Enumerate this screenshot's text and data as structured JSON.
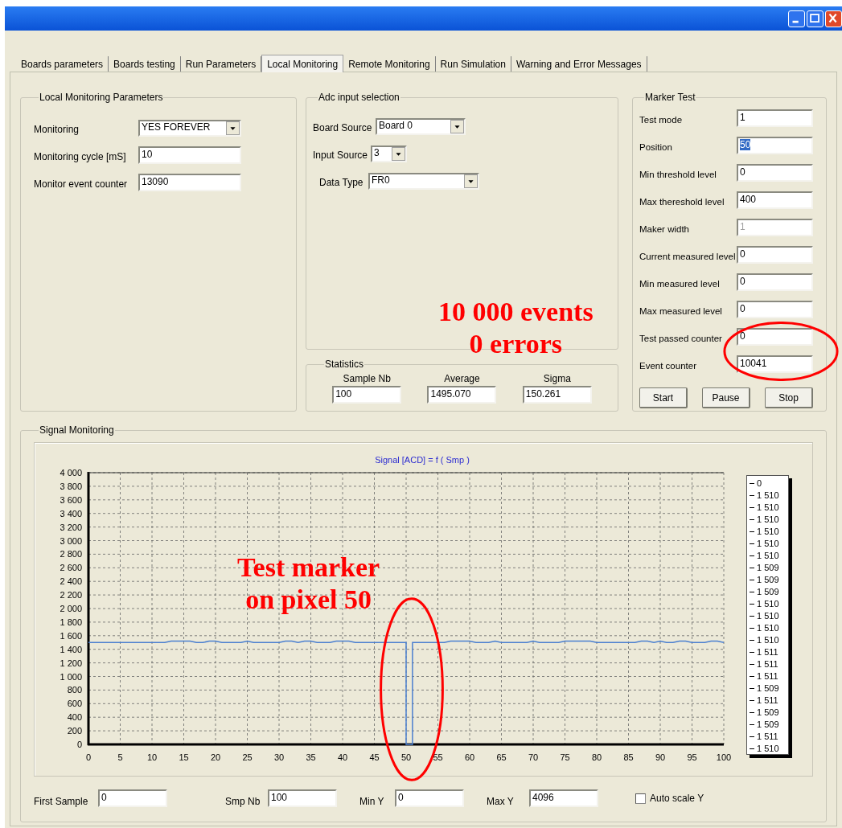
{
  "window": {
    "controls": [
      {
        "kind": "minimize"
      },
      {
        "kind": "maximize"
      },
      {
        "kind": "close"
      }
    ]
  },
  "tabs": [
    {
      "label": "Boards parameters",
      "selected": false
    },
    {
      "label": "Boards testing",
      "selected": false
    },
    {
      "label": "Run Parameters",
      "selected": false
    },
    {
      "label": "Local Monitoring",
      "selected": true
    },
    {
      "label": "Remote Monitoring",
      "selected": false
    },
    {
      "label": "Run Simulation",
      "selected": false
    },
    {
      "label": "Warning and Error Messages",
      "selected": false
    }
  ],
  "local_monitoring_parameters": {
    "title": "Local Monitoring Parameters",
    "rows": [
      {
        "label": "Monitoring",
        "kind": "dropdown",
        "value": "YES FOREVER"
      },
      {
        "label": "Monitoring cycle [mS]",
        "kind": "input",
        "value": "10"
      },
      {
        "label": "Monitor event counter",
        "kind": "input",
        "value": "13090"
      }
    ]
  },
  "adc_input_selection": {
    "title": "Adc input selection",
    "rows": [
      {
        "label": "Board Source",
        "kind": "dropdown",
        "value": "Board 0"
      },
      {
        "label": "Input Source",
        "kind": "dropdown",
        "value": "3"
      },
      {
        "label": "Data Type",
        "kind": "dropdown",
        "value": "FR0"
      }
    ]
  },
  "statistics": {
    "title": "Statistics",
    "columns": [
      {
        "label": "Sample Nb",
        "value": "100"
      },
      {
        "label": "Average",
        "value": "1495.070"
      },
      {
        "label": "Sigma",
        "value": "150.261"
      }
    ]
  },
  "marker_test": {
    "title": "Marker Test",
    "rows": [
      {
        "label": "Test mode",
        "value": "1",
        "disabled": false,
        "text_selected": false
      },
      {
        "label": "Position",
        "value": "50",
        "disabled": false,
        "text_selected": true
      },
      {
        "label": "Min threshold level",
        "value": "0",
        "disabled": false,
        "text_selected": false
      },
      {
        "label": "Max thereshold level",
        "value": "400",
        "disabled": false,
        "text_selected": false
      },
      {
        "label": "Maker width",
        "value": "1",
        "disabled": true,
        "text_selected": false
      },
      {
        "label": "Current measured level",
        "value": "0",
        "disabled": false,
        "text_selected": false
      },
      {
        "label": "Min measured level",
        "value": "0",
        "disabled": false,
        "text_selected": false
      },
      {
        "label": "Max measured level",
        "value": "0",
        "disabled": false,
        "text_selected": false
      },
      {
        "label": "Test passed counter",
        "value": "0",
        "disabled": false,
        "text_selected": false
      },
      {
        "label": "Event counter",
        "value": "10041",
        "disabled": false,
        "text_selected": false
      }
    ],
    "buttons": [
      "Start",
      "Pause",
      "Stop"
    ]
  },
  "signal_monitoring": {
    "title": "Signal Monitoring",
    "chart_data": {
      "type": "line",
      "title": "Signal [ACD] = f ( Smp )",
      "grid": true,
      "xlim": [
        0,
        100
      ],
      "ylim": [
        0,
        4000
      ],
      "xticks": [
        0,
        5,
        10,
        15,
        20,
        25,
        30,
        35,
        40,
        45,
        50,
        55,
        60,
        65,
        70,
        75,
        80,
        85,
        90,
        95,
        100
      ],
      "yticks": [
        {
          "value": 4000,
          "label": "4 000"
        },
        {
          "value": 3800,
          "label": "3 800"
        },
        {
          "value": 3600,
          "label": "3 600"
        },
        {
          "value": 3400,
          "label": "3 400"
        },
        {
          "value": 3200,
          "label": "3 200"
        },
        {
          "value": 3000,
          "label": "3 000"
        },
        {
          "value": 2800,
          "label": "2 800"
        },
        {
          "value": 2600,
          "label": "2 600"
        },
        {
          "value": 2400,
          "label": "2 400"
        },
        {
          "value": 2200,
          "label": "2 200"
        },
        {
          "value": 2000,
          "label": "2 000"
        },
        {
          "value": 1800,
          "label": "1 800"
        },
        {
          "value": 1600,
          "label": "1 600"
        },
        {
          "value": 1400,
          "label": "1 400"
        },
        {
          "value": 1200,
          "label": "1 200"
        },
        {
          "value": 1000,
          "label": "1 000"
        },
        800,
        600,
        400,
        200,
        0
      ],
      "x": [
        0,
        1,
        2,
        3,
        4,
        5,
        6,
        7,
        8,
        9,
        10,
        11,
        12,
        13,
        14,
        15,
        16,
        17,
        18,
        19,
        20,
        21,
        22,
        23,
        24,
        25,
        26,
        27,
        28,
        29,
        30,
        31,
        32,
        33,
        34,
        35,
        36,
        37,
        38,
        39,
        40,
        41,
        42,
        43,
        44,
        45,
        46,
        47,
        48,
        49,
        50,
        50,
        51,
        51,
        52,
        53,
        54,
        55,
        56,
        57,
        58,
        59,
        60,
        61,
        62,
        63,
        64,
        65,
        66,
        67,
        68,
        69,
        70,
        71,
        72,
        73,
        74,
        75,
        76,
        77,
        78,
        79,
        80,
        81,
        82,
        83,
        84,
        85,
        86,
        87,
        88,
        89,
        90,
        91,
        92,
        93,
        94,
        95,
        96,
        97,
        98,
        99,
        100
      ],
      "series": [
        {
          "color": "#4a7fd0",
          "values": [
            1500,
            1500,
            1500,
            1500,
            1500,
            1500,
            1500,
            1500,
            1500,
            1500,
            1500,
            1500,
            1500,
            1520,
            1520,
            1520,
            1520,
            1500,
            1500,
            1520,
            1520,
            1500,
            1500,
            1500,
            1500,
            1520,
            1500,
            1500,
            1500,
            1500,
            1500,
            1520,
            1520,
            1500,
            1520,
            1520,
            1500,
            1500,
            1500,
            1520,
            1520,
            1520,
            1500,
            1500,
            1500,
            1500,
            1500,
            1500,
            1500,
            1500,
            1500,
            0,
            0,
            1500,
            1500,
            1500,
            1500,
            1500,
            1500,
            1520,
            1520,
            1520,
            1520,
            1500,
            1500,
            1500,
            1520,
            1500,
            1500,
            1500,
            1500,
            1500,
            1520,
            1500,
            1500,
            1500,
            1500,
            1520,
            1520,
            1520,
            1520,
            1520,
            1500,
            1500,
            1500,
            1500,
            1500,
            1500,
            1500,
            1520,
            1520,
            1500,
            1520,
            1500,
            1500,
            1520,
            1520,
            1500,
            1500,
            1500,
            1520,
            1520,
            1500
          ]
        }
      ]
    },
    "legend": [
      "0",
      "1 510",
      "1 510",
      "1 510",
      "1 510",
      "1 510",
      "1 510",
      "1 509",
      "1 509",
      "1 509",
      "1 510",
      "1 510",
      "1 510",
      "1 510",
      "1 511",
      "1 511",
      "1 511",
      "1 509",
      "1 511",
      "1 509",
      "1 509",
      "1 511",
      "1 510"
    ],
    "fields": [
      {
        "label": "First Sample",
        "value": "0"
      },
      {
        "label": "Smp Nb",
        "value": "100"
      },
      {
        "label": "Min Y",
        "value": "0"
      },
      {
        "label": "Max Y",
        "value": "4096"
      }
    ],
    "auto_scale": {
      "label": "Auto scale Y",
      "checked": false
    }
  },
  "annotations": [
    {
      "kind": "text",
      "lines": [
        "10 000 events",
        "0 errors"
      ]
    },
    {
      "kind": "ellipse"
    },
    {
      "kind": "text",
      "lines": [
        "Test marker",
        "on pixel 50"
      ]
    },
    {
      "kind": "ellipse"
    }
  ]
}
